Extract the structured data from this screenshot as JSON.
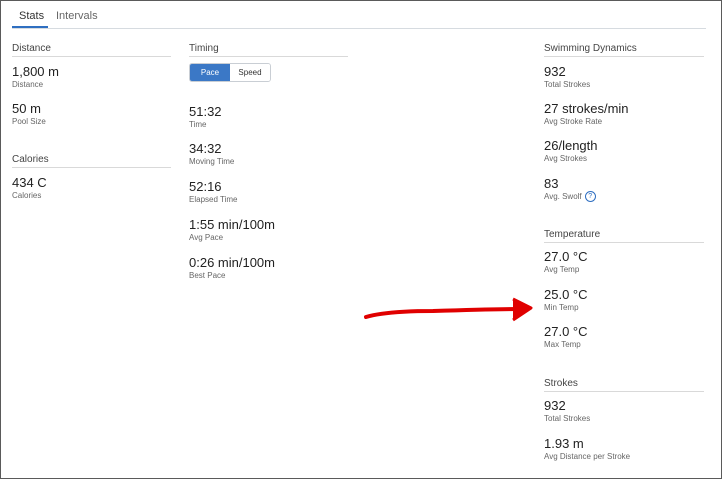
{
  "tabs": [
    {
      "label": "Stats"
    },
    {
      "label": "Intervals"
    }
  ],
  "distance": {
    "title": "Distance",
    "stats": [
      {
        "value": "1,800 m",
        "label": "Distance"
      },
      {
        "value": "50 m",
        "label": "Pool Size"
      }
    ]
  },
  "calories": {
    "title": "Calories",
    "stats": [
      {
        "value": "434 C",
        "label": "Calories"
      }
    ]
  },
  "timing": {
    "title": "Timing",
    "toggle": {
      "pace": "Pace",
      "speed": "Speed",
      "selected": "Pace"
    },
    "stats": [
      {
        "value": "51:32",
        "label": "Time"
      },
      {
        "value": "34:32",
        "label": "Moving Time"
      },
      {
        "value": "52:16",
        "label": "Elapsed Time"
      },
      {
        "value": "1:55 min/100m",
        "label": "Avg Pace"
      },
      {
        "value": "0:26 min/100m",
        "label": "Best Pace"
      }
    ]
  },
  "swimming_dynamics": {
    "title": "Swimming Dynamics",
    "stats": [
      {
        "value": "932",
        "label": "Total Strokes"
      },
      {
        "value": "27 strokes/min",
        "label": "Avg Stroke Rate"
      },
      {
        "value": "26/length",
        "label": "Avg Strokes"
      },
      {
        "value": "83",
        "label": "Avg. Swolf"
      }
    ],
    "info_icon": "?"
  },
  "temperature": {
    "title": "Temperature",
    "stats": [
      {
        "value": "27.0 °C",
        "label": "Avg Temp"
      },
      {
        "value": "25.0 °C",
        "label": "Min Temp"
      },
      {
        "value": "27.0 °C",
        "label": "Max Temp"
      }
    ]
  },
  "strokes": {
    "title": "Strokes",
    "stats": [
      {
        "value": "932",
        "label": "Total Strokes"
      },
      {
        "value": "1.93 m",
        "label": "Avg Distance per Stroke"
      }
    ]
  },
  "annotation": {
    "arrow_color": "#e00000",
    "icon": "red-arrow-annotation"
  },
  "colors": {
    "accent": "#3b78c6"
  }
}
